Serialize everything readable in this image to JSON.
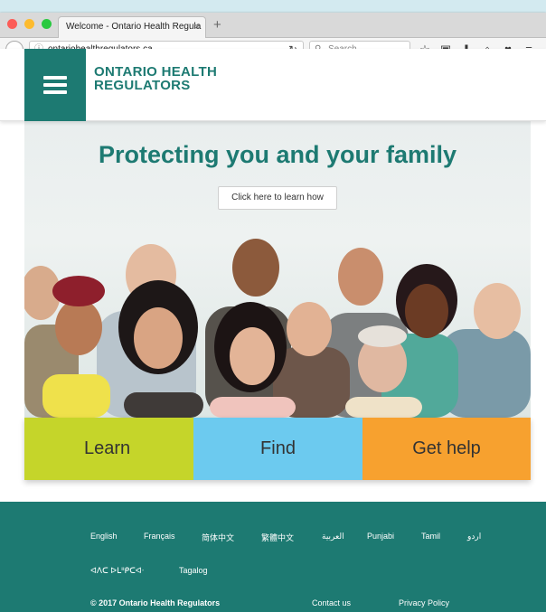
{
  "browser": {
    "tab_title": "Welcome - Ontario Health Regula",
    "tab_close": "×",
    "new_tab": "+",
    "url": "ontariohealthregulators.ca",
    "search_placeholder": "Search",
    "toolbar_icons": [
      "star-icon",
      "clipboard-icon",
      "download-icon",
      "home-icon",
      "pocket-icon",
      "menu-icon"
    ]
  },
  "header": {
    "logo_line1": "ONTARIO HEALTH",
    "logo_line2": "REGULATORS"
  },
  "hero": {
    "title": "Protecting you and your family",
    "cta_label": "Click here to learn how"
  },
  "tiles": {
    "learn": "Learn",
    "find": "Find",
    "help": "Get help"
  },
  "footer": {
    "languages_row1": [
      "English",
      "Français",
      "简体中文",
      "繁體中文",
      "العربية",
      "Punjabi",
      "Tamil",
      "اردو"
    ],
    "languages_row2": [
      "ᐊᐱᑕ ᐅᒪᐦᑭᑕᐊᐧ",
      "Tagalog"
    ],
    "copyright": "© 2017 Ontario Health Regulators",
    "contact": "Contact us",
    "privacy": "Privacy Policy"
  },
  "colors": {
    "teal": "#1d7a72",
    "learn": "#c5d52a",
    "find": "#6ccaef",
    "help": "#f7a12f"
  }
}
